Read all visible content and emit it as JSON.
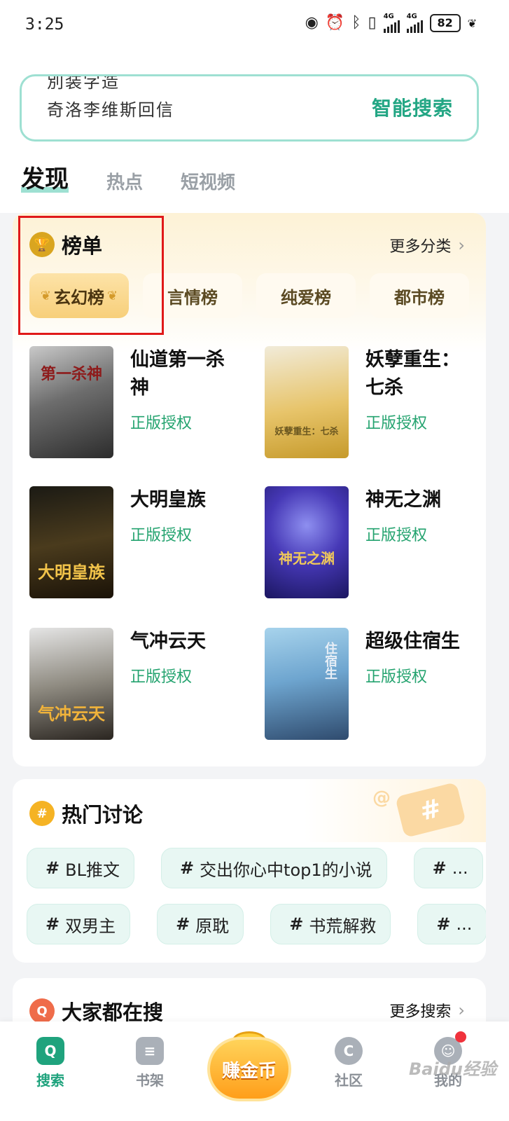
{
  "status": {
    "time": "3:25",
    "battery": "82",
    "net1": "4G",
    "net2": "4G"
  },
  "search": {
    "line1": "別装字造",
    "line2": "奇洛李维斯回信",
    "button": "智能搜索"
  },
  "tabs": [
    "发现",
    "热点",
    "短视频"
  ],
  "ranking": {
    "title": "榜单",
    "more": "更多分类",
    "categories": [
      "玄幻榜",
      "言情榜",
      "纯爱榜",
      "都市榜"
    ],
    "books": [
      {
        "title": "仙道第一杀神",
        "tag": "正版授权",
        "cover_text": "第一杀神"
      },
      {
        "title": "妖孽重生：七杀",
        "tag": "正版授权",
        "cover_text": "妖孽重生：七杀"
      },
      {
        "title": "大明皇族",
        "tag": "正版授权",
        "cover_text": "大明皇族"
      },
      {
        "title": "神无之渊",
        "tag": "正版授权",
        "cover_text": "神无之渊"
      },
      {
        "title": "气冲云天",
        "tag": "正版授权",
        "cover_text": "气冲云天"
      },
      {
        "title": "超级住宿生",
        "tag": "正版授权",
        "cover_text": "住宿生"
      }
    ]
  },
  "hot": {
    "title": "热门讨论",
    "row1": [
      "BL推文",
      "交出你心中top1的小说",
      "..."
    ],
    "row2": [
      "双男主",
      "原耽",
      "书荒解救",
      "..."
    ]
  },
  "everyone_search": {
    "title": "大家都在搜",
    "more": "更多搜索"
  },
  "nav": {
    "search": "搜索",
    "shelf": "书架",
    "coins": "赚金币",
    "community": "社区",
    "mine": "我的"
  },
  "watermark": "Baidu经验"
}
